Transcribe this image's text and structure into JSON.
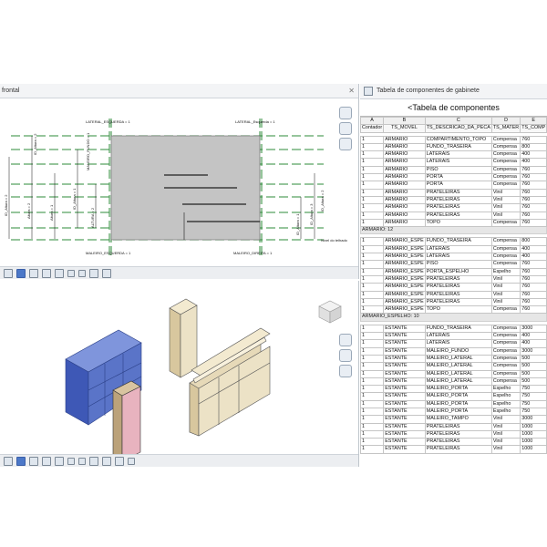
{
  "elevation": {
    "view_title": "frontal",
    "labels": {
      "lateral_left": "LATERAL_ESQUERDA = 1",
      "lateral_right": "LATERAL_Esquerda = 1",
      "maleiro_fundo": "MALEIRO_FUNDO = 1",
      "maleiro_bottom_left": "MALEIRO_ESQUERDA = 1",
      "maleiro_bottom_right": "MALEIRO_DIREITA = 1",
      "nivel": "Nível do telhado",
      "dim_left_1": "ID_Altura = 2",
      "dim_left_2": "Altura = 2",
      "dim_left_3": "Altura = 1",
      "dim_left_4": "ID_Altura = 1",
      "dim_left_5": "ALTURA = 2",
      "dim_right_1": "ID_Altura = 1",
      "dim_right_2": "ID_Altura = 3",
      "dim_right_3": "ID_Altura = 2",
      "dim_top": "ID_Altura = 2"
    }
  },
  "schedule": {
    "tab_title": "Tabela de componentes de gabinete",
    "title": "<Tabela de componentes",
    "column_letters": [
      "A",
      "B",
      "C",
      "D",
      "E"
    ],
    "columns": [
      "Contador",
      "TS_MOVEL",
      "TS_DESCRICAO_DA_PECA",
      "TS_MATER",
      "TS_COMP"
    ],
    "groups": [
      {
        "rows": [
          [
            "1",
            "ARMARIO",
            "COMPARTIMENTO_TOPO",
            "Compensa",
            "760"
          ],
          [
            "1",
            "ARMARIO",
            "FUNDO_TRASEIRA",
            "Compensa",
            "800"
          ],
          [
            "1",
            "ARMARIO",
            "LATERAIS",
            "Compensa",
            "400"
          ],
          [
            "1",
            "ARMARIO",
            "LATERAIS",
            "Compensa",
            "400"
          ],
          [
            "1",
            "ARMARIO",
            "PISO",
            "Compensa",
            "760"
          ],
          [
            "1",
            "ARMARIO",
            "PORTA",
            "Compensa",
            "760"
          ],
          [
            "1",
            "ARMARIO",
            "PORTA",
            "Compensa",
            "760"
          ],
          [
            "1",
            "ARMARIO",
            "PRATELEIRAS",
            "Vinil",
            "760"
          ],
          [
            "1",
            "ARMARIO",
            "PRATELEIRAS",
            "Vinil",
            "760"
          ],
          [
            "1",
            "ARMARIO",
            "PRATELEIRAS",
            "Vinil",
            "760"
          ],
          [
            "1",
            "ARMARIO",
            "PRATELEIRAS",
            "Vinil",
            "760"
          ],
          [
            "1",
            "ARMARIO",
            "TOPO",
            "Compensa",
            "760"
          ]
        ],
        "footer": "ARMARIO: 12"
      },
      {
        "rows": [
          [
            "1",
            "ARMARIO_ESPE",
            "FUNDO_TRASEIRA",
            "Compensa",
            "800"
          ],
          [
            "1",
            "ARMARIO_ESPE",
            "LATERAIS",
            "Compensa",
            "400"
          ],
          [
            "1",
            "ARMARIO_ESPE",
            "LATERAIS",
            "Compensa",
            "400"
          ],
          [
            "1",
            "ARMARIO_ESPE",
            "PISO",
            "Compensa",
            "760"
          ],
          [
            "1",
            "ARMARIO_ESPE",
            "PORTA_ESPELHO",
            "Espelho",
            "760"
          ],
          [
            "1",
            "ARMARIO_ESPE",
            "PRATELEIRAS",
            "Vinil",
            "760"
          ],
          [
            "1",
            "ARMARIO_ESPE",
            "PRATELEIRAS",
            "Vinil",
            "760"
          ],
          [
            "1",
            "ARMARIO_ESPE",
            "PRATELEIRAS",
            "Vinil",
            "760"
          ],
          [
            "1",
            "ARMARIO_ESPE",
            "PRATELEIRAS",
            "Vinil",
            "760"
          ],
          [
            "1",
            "ARMARIO_ESPE",
            "TOPO",
            "Compensa",
            "760"
          ]
        ],
        "footer": "ARMARIO_ESPELHO: 10"
      },
      {
        "rows": [
          [
            "1",
            "ESTANTE",
            "FUNDO_TRASEIRA",
            "Compensa",
            "3000"
          ],
          [
            "1",
            "ESTANTE",
            "LATERAIS",
            "Compensa",
            "400"
          ],
          [
            "1",
            "ESTANTE",
            "LATERAIS",
            "Compensa",
            "400"
          ],
          [
            "1",
            "ESTANTE",
            "MALEIRO_FUNDO",
            "Compensa",
            "3000"
          ],
          [
            "1",
            "ESTANTE",
            "MALEIRO_LATERAL",
            "Compensa",
            "500"
          ],
          [
            "1",
            "ESTANTE",
            "MALEIRO_LATERAL",
            "Compensa",
            "500"
          ],
          [
            "1",
            "ESTANTE",
            "MALEIRO_LATERAL",
            "Compensa",
            "500"
          ],
          [
            "1",
            "ESTANTE",
            "MALEIRO_LATERAL",
            "Compensa",
            "500"
          ],
          [
            "1",
            "ESTANTE",
            "MALEIRO_PORTA",
            "Espelho",
            "750"
          ],
          [
            "1",
            "ESTANTE",
            "MALEIRO_PORTA",
            "Espelho",
            "750"
          ],
          [
            "1",
            "ESTANTE",
            "MALEIRO_PORTA",
            "Espelho",
            "750"
          ],
          [
            "1",
            "ESTANTE",
            "MALEIRO_PORTA",
            "Espelho",
            "750"
          ],
          [
            "1",
            "ESTANTE",
            "MALEIRO_TAMPO",
            "Vinil",
            "3000"
          ],
          [
            "1",
            "ESTANTE",
            "PRATELEIRAS",
            "Vinil",
            "1000"
          ],
          [
            "1",
            "ESTANTE",
            "PRATELEIRAS",
            "Vinil",
            "1000"
          ],
          [
            "1",
            "ESTANTE",
            "PRATELEIRAS",
            "Vinil",
            "1000"
          ],
          [
            "1",
            "ESTANTE",
            "PRATELEIRAS",
            "Vinil",
            "1000"
          ]
        ],
        "footer": ""
      }
    ]
  },
  "colors": {
    "guide_green": "#2e8b3a",
    "panel_gray": "#c4c4c4",
    "wood": "#ece2c6",
    "blue_selected": "#5a74c8",
    "pink": "#e8b3bf"
  }
}
